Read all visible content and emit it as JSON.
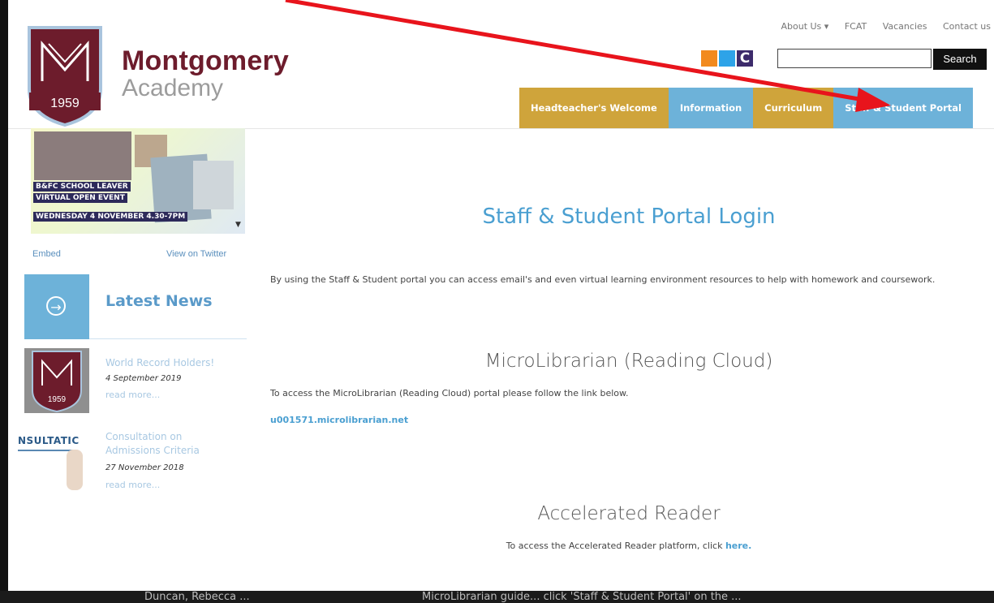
{
  "brand": {
    "name": "Montgomery",
    "sub": "Academy",
    "crest_year": "1959"
  },
  "top_links": [
    "About Us ▾",
    "FCAT",
    "Vacancies",
    "Contact us"
  ],
  "search": {
    "button_label": "Search",
    "placeholder": ""
  },
  "social": {
    "c_label": "C"
  },
  "nav": {
    "items": [
      {
        "label": "Headteacher's Welcome",
        "color": "#cfa43b"
      },
      {
        "label": "Information",
        "color": "#6db2d9"
      },
      {
        "label": "Curriculum",
        "color": "#cfa43b"
      },
      {
        "label": "Staff & Student Portal",
        "color": "#6db2d9"
      }
    ]
  },
  "sidebar": {
    "promo": {
      "line1": "B&FC SCHOOL LEAVER",
      "line2": "VIRTUAL OPEN EVENT",
      "line3": "WEDNESDAY 4 NOVEMBER 4.30-7PM"
    },
    "embed": "Embed",
    "view_twitter": "View on Twitter",
    "latest_news": "Latest News",
    "news": [
      {
        "title": "World Record Holders!",
        "date": "4 September 2019",
        "more": "read more..."
      },
      {
        "title": "Consultation on Admissions Criteria",
        "date": "27 November 2018",
        "more": "read more...",
        "thumb_text": "NSULTATIC"
      }
    ]
  },
  "main": {
    "title": "Staff & Student Portal Login",
    "intro": "By using the Staff & Student portal you can access email's and even virtual learning environment resources to help with homework and coursework.",
    "microlibrarian": {
      "title": "MicroLibrarian (Reading Cloud)",
      "text": "To access the MicroLibrarian (Reading Cloud) portal please follow the link below.",
      "link": "u001571.microlibrarian.net"
    },
    "accelerated": {
      "title": "Accelerated Reader",
      "text": "To access the Accelerated Reader platform, click ",
      "link": "here."
    }
  },
  "bottom_bar": {
    "t1": "Duncan, Rebecca ...",
    "t2": "MicroLibrarian guide... click 'Staff & Student Portal' on the ..."
  },
  "colors": {
    "accent_gold": "#cfa43b",
    "accent_blue": "#6db2d9",
    "brand_maroon": "#6d1c2c",
    "arrow_red": "#e8141c"
  }
}
